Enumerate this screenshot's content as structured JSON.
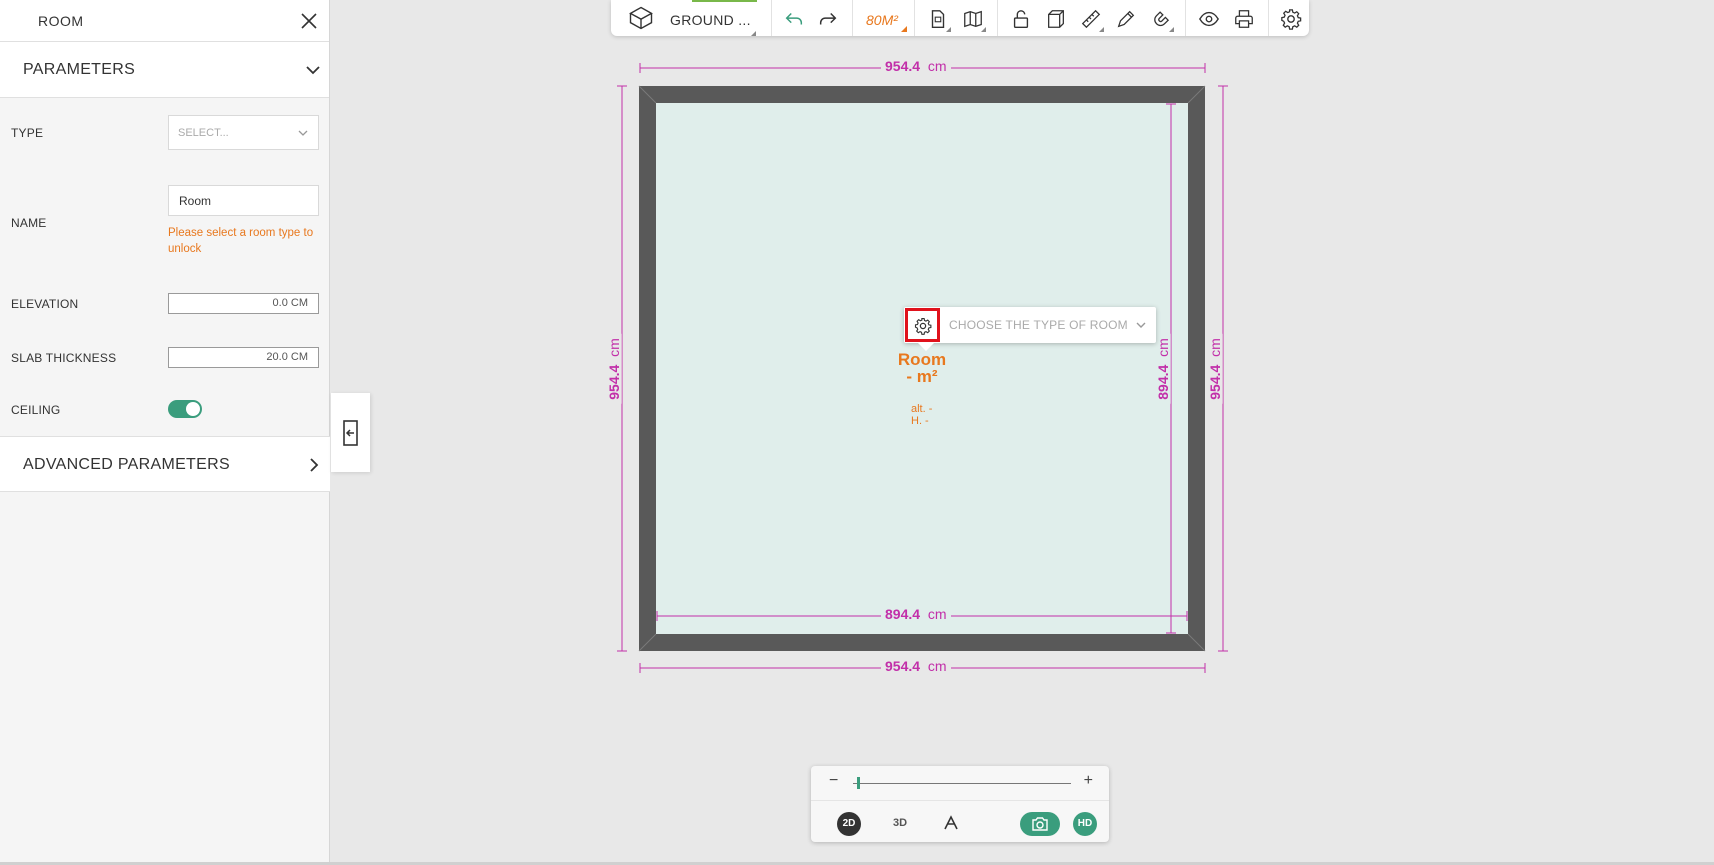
{
  "panel": {
    "title": "ROOM",
    "parameters_title": "PARAMETERS",
    "type_label": "TYPE",
    "type_placeholder": "SELECT...",
    "name_label": "NAME",
    "name_value": "Room",
    "name_warning": "Please select a room type to unlock",
    "elevation_label": "ELEVATION",
    "elevation_value": "0.0  CM",
    "slab_label": "SLAB THICKNESS",
    "slab_value": "20.0  CM",
    "ceiling_label": "CEILING",
    "ceiling_on": true,
    "advanced_title": "ADVANCED PARAMETERS"
  },
  "toolbar": {
    "floor_label": "GROUND ...",
    "area_label": "80M²",
    "icons": [
      "cube-icon",
      "undo-icon",
      "redo-icon",
      "document-icon",
      "map-icon",
      "unlock-icon",
      "box-icon",
      "ruler-icon",
      "pen-icon",
      "magnet-icon",
      "eye-icon",
      "print-icon",
      "gear-icon"
    ]
  },
  "plan": {
    "dims": {
      "top_value": "954.4",
      "bottom_value": "954.4",
      "inner_bottom_value": "894.4",
      "left_value": "954.4",
      "right_value": "954.4",
      "inner_right_value": "894.4",
      "unit": "cm"
    },
    "colors": {
      "wall": "#595959",
      "floor": "#e0eeeb",
      "dimension": "#c22fa9",
      "accent": "#e8781e",
      "highlight": "#e0121c"
    },
    "room_popup_placeholder": "CHOOSE THE TYPE OF ROOM",
    "room_name": "Room",
    "room_area": "- m²",
    "alt_label": "alt. -",
    "height_label": "H.  -"
  },
  "viewbar": {
    "zoom_minus": "−",
    "zoom_plus": "+",
    "zoom_level": 0.02,
    "mode_2d": "2D",
    "mode_3d": "3D",
    "hd": "HD",
    "active_mode": "2D"
  }
}
